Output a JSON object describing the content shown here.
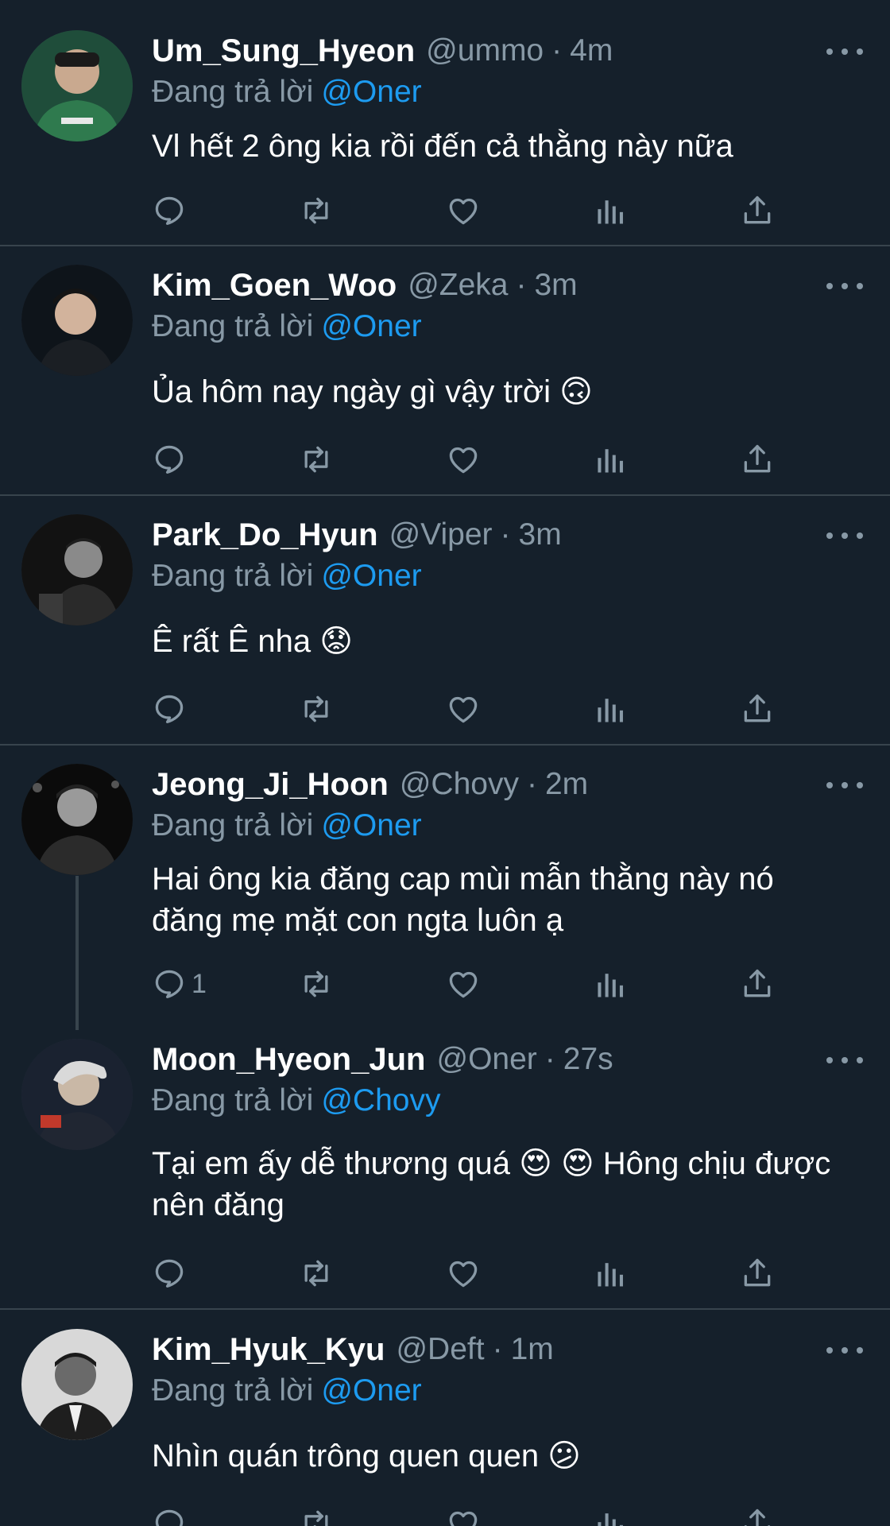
{
  "replying_label": "Đang trả lời",
  "colors": {
    "background": "#15202b",
    "secondary_text": "#8899a6",
    "mention": "#1d9bf0",
    "divider": "#38444d"
  },
  "icons": [
    "reply-icon",
    "retweet-icon",
    "like-icon",
    "analytics-icon",
    "share-icon",
    "more-icon"
  ],
  "tweets": [
    {
      "name": "Um_Sung_Hyeon",
      "handle": "@ummo",
      "sep": "·",
      "time": "4m",
      "mention": "@Oner",
      "text": "Vl hết 2 ông kia rồi đến cả thằng này nữa",
      "reply_count": ""
    },
    {
      "name": "Kim_Goen_Woo",
      "handle": "@Zeka",
      "sep": "·",
      "time": "3m",
      "mention": "@Oner",
      "text": "Ủa hôm nay ngày gì vậy trời 🙃",
      "reply_count": ""
    },
    {
      "name": "Park_Do_Hyun",
      "handle": "@Viper",
      "sep": "·",
      "time": "3m",
      "mention": "@Oner",
      "text": "Ê rất Ê nha 😟",
      "reply_count": ""
    },
    {
      "name": "Jeong_Ji_Hoon",
      "handle": "@Chovy",
      "sep": "·",
      "time": "2m",
      "mention": "@Oner",
      "text": "Hai ông kia đăng cap mùi mẫn thằng này nó đăng mẹ mặt con ngta luôn ạ",
      "reply_count": "1"
    },
    {
      "name": "Moon_Hyeon_Jun",
      "handle": "@Oner",
      "sep": "·",
      "time": "27s",
      "mention": "@Chovy",
      "text": "Tại em ấy dễ thương quá 😍 😍  Hông chịu được nên đăng",
      "reply_count": ""
    },
    {
      "name": "Kim_Hyuk_Kyu",
      "handle": "@Deft",
      "sep": "·",
      "time": "1m",
      "mention": "@Oner",
      "text": "Nhìn quán trông quen quen 😕",
      "reply_count": ""
    }
  ]
}
